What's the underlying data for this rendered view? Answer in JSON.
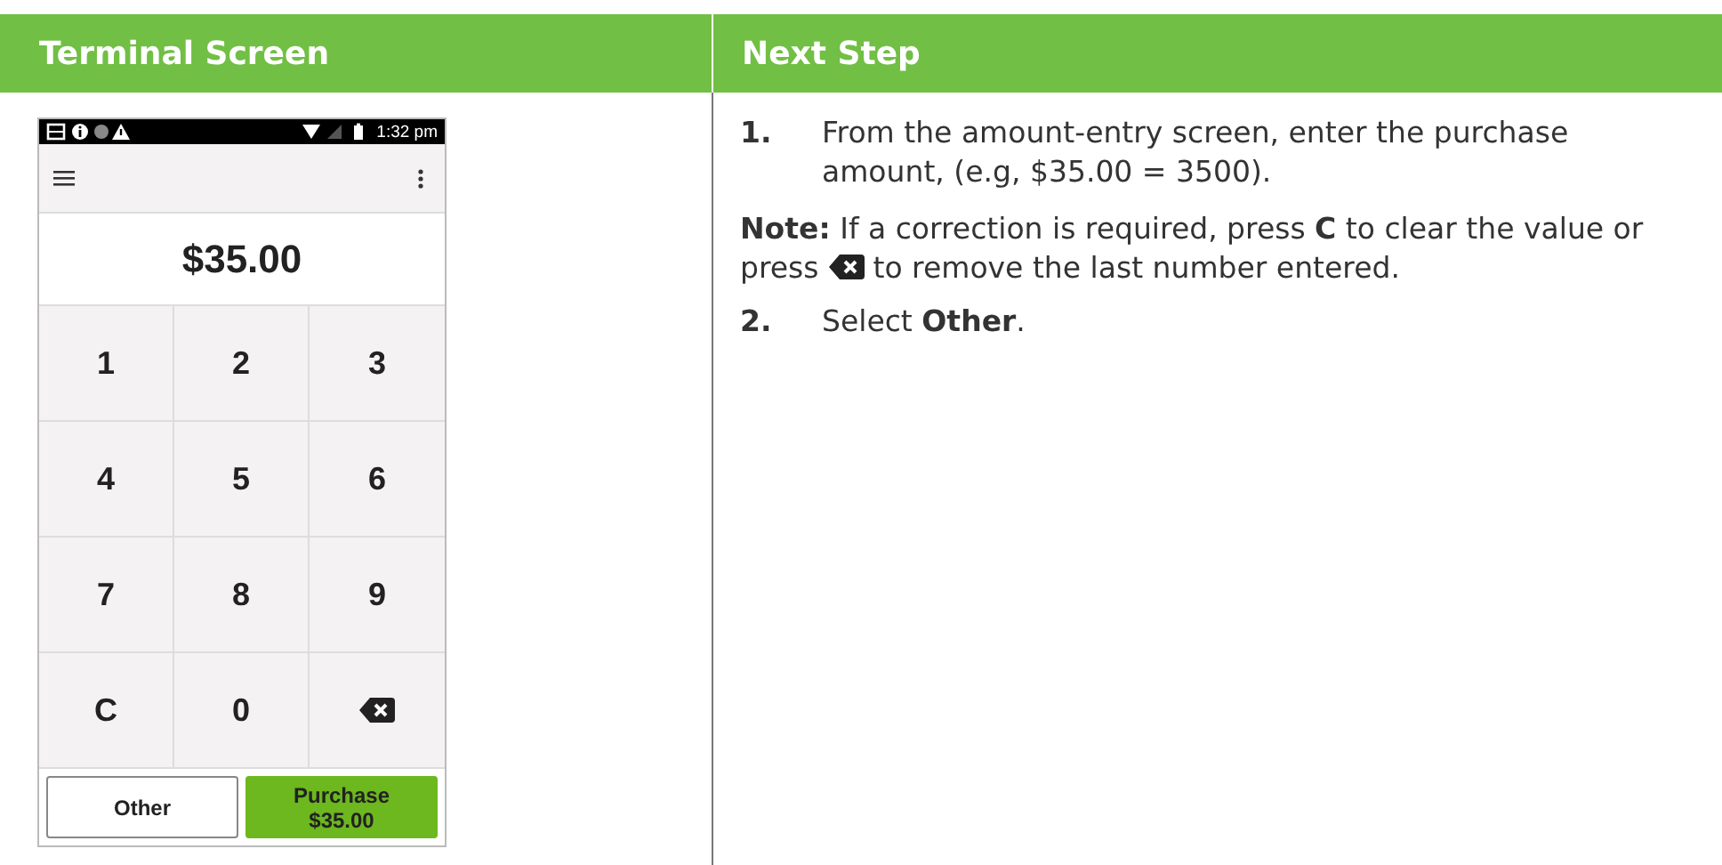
{
  "header": {
    "left_title": "Terminal Screen",
    "right_title": "Next Step"
  },
  "terminal": {
    "status_time": "1:32 pm",
    "amount": "$35.00",
    "keys": [
      {
        "kind": "digit",
        "label": "1"
      },
      {
        "kind": "digit",
        "label": "2"
      },
      {
        "kind": "digit",
        "label": "3"
      },
      {
        "kind": "digit",
        "label": "4"
      },
      {
        "kind": "digit",
        "label": "5"
      },
      {
        "kind": "digit",
        "label": "6"
      },
      {
        "kind": "digit",
        "label": "7"
      },
      {
        "kind": "digit",
        "label": "8"
      },
      {
        "kind": "digit",
        "label": "9"
      },
      {
        "kind": "clear",
        "label": "C"
      },
      {
        "kind": "digit",
        "label": "0"
      },
      {
        "kind": "backspace"
      }
    ],
    "buttons": [
      {
        "kind": "secondary",
        "lines": [
          "Other"
        ]
      },
      {
        "kind": "primary",
        "lines": [
          "Purchase",
          "$35.00"
        ]
      }
    ]
  },
  "steps": [
    {
      "kind": "step",
      "number": "1.",
      "text": "From the amount-entry screen, enter the purchase amount, (e.g, $35.00 = 3500)."
    },
    {
      "kind": "note",
      "text_before": "**Note:** If a correction is required, press **C** to clear the value or press",
      "text_after": "to remove the last number entered."
    },
    {
      "kind": "step",
      "number": "2.",
      "text": "Select **Other**."
    }
  ]
}
